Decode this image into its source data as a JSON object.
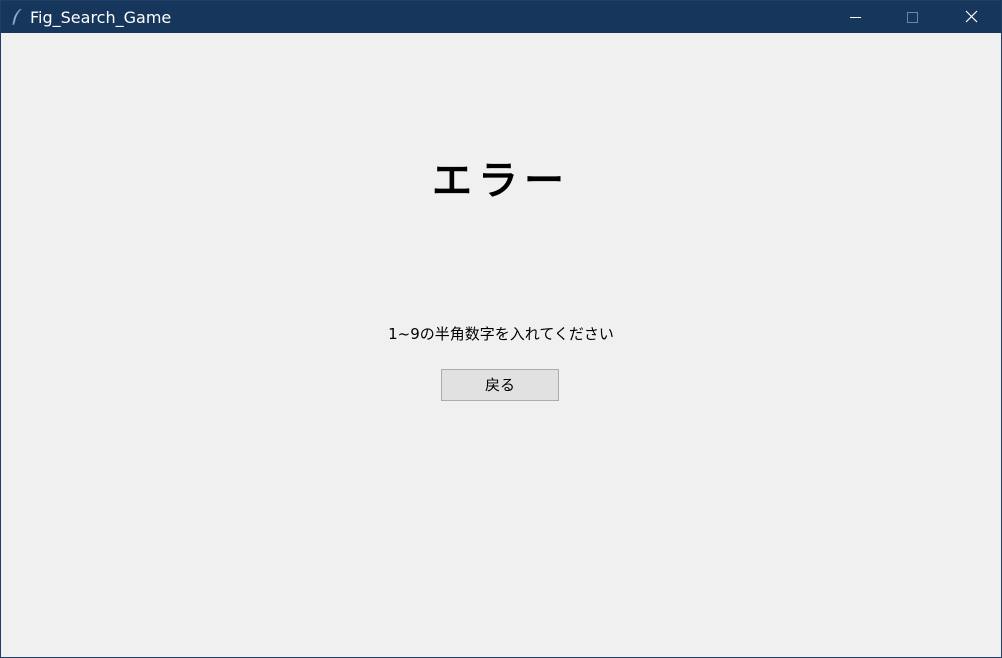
{
  "window": {
    "title": "Fig_Search_Game",
    "icon": "feather-icon",
    "controls": {
      "minimize": "minimize-icon",
      "maximize": "maximize-icon",
      "close": "close-icon"
    }
  },
  "content": {
    "heading": "エラー",
    "message": "1~9の半角数字を入れてください",
    "back_button_label": "戻る"
  },
  "colors": {
    "titlebar": "#16365b",
    "background": "#f0f0f0",
    "button": "#e1e1e1"
  }
}
